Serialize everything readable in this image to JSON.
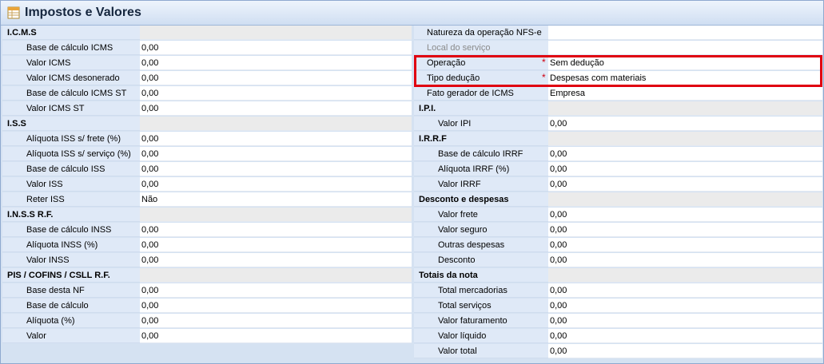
{
  "title": "Impostos e Valores",
  "left": [
    {
      "cat": true,
      "label": "I.C.M.S",
      "value": ""
    },
    {
      "label": "Base de cálculo ICMS",
      "value": "0,00"
    },
    {
      "label": "Valor ICMS",
      "value": "0,00"
    },
    {
      "label": "Valor ICMS desonerado",
      "value": "0,00"
    },
    {
      "label": "Base de cálculo ICMS ST",
      "value": "0,00"
    },
    {
      "label": "Valor ICMS ST",
      "value": "0,00"
    },
    {
      "cat": true,
      "label": "I.S.S",
      "value": ""
    },
    {
      "label": "Alíquota ISS s/ frete (%)",
      "value": "0,00"
    },
    {
      "label": "Alíquota ISS s/ serviço (%)",
      "value": "0,00"
    },
    {
      "label": "Base de cálculo ISS",
      "value": "0,00"
    },
    {
      "label": "Valor ISS",
      "value": "0,00"
    },
    {
      "label": "Reter ISS",
      "value": "Não"
    },
    {
      "cat": true,
      "label": "I.N.S.S R.F.",
      "value": ""
    },
    {
      "label": "Base de cálculo INSS",
      "value": "0,00"
    },
    {
      "label": "Alíquota INSS (%)",
      "value": "0,00"
    },
    {
      "label": "Valor INSS",
      "value": "0,00"
    },
    {
      "cat": true,
      "label": "PIS / COFINS / CSLL R.F.",
      "value": ""
    },
    {
      "label": "Base desta NF",
      "value": "0,00"
    },
    {
      "label": "Base de cálculo",
      "value": "0,00"
    },
    {
      "label": "Alíquota (%)",
      "value": "0,00"
    },
    {
      "label": "Valor",
      "value": "0,00"
    }
  ],
  "right": [
    {
      "top": true,
      "label": "Natureza da operação NFS-e",
      "value": ""
    },
    {
      "top": true,
      "dis": true,
      "label": "Local do serviço",
      "value": ""
    },
    {
      "top": true,
      "req": true,
      "label": "Operação",
      "value": "Sem dedução"
    },
    {
      "top": true,
      "req": true,
      "label": "Tipo dedução",
      "value": "Despesas com materiais"
    },
    {
      "top": true,
      "label": "Fato gerador de ICMS",
      "value": "Empresa"
    },
    {
      "cat": true,
      "label": "I.P.I.",
      "value": ""
    },
    {
      "label": "Valor IPI",
      "value": "0,00"
    },
    {
      "cat": true,
      "label": "I.R.R.F",
      "value": ""
    },
    {
      "label": "Base de cálculo IRRF",
      "value": "0,00"
    },
    {
      "label": "Alíquota IRRF (%)",
      "value": "0,00"
    },
    {
      "label": "Valor IRRF",
      "value": "0,00"
    },
    {
      "cat": true,
      "label": "Desconto e despesas",
      "value": ""
    },
    {
      "label": "Valor frete",
      "value": "0,00"
    },
    {
      "label": "Valor seguro",
      "value": "0,00"
    },
    {
      "label": "Outras despesas",
      "value": "0,00"
    },
    {
      "label": "Desconto",
      "value": "0,00"
    },
    {
      "cat": true,
      "label": "Totais da nota",
      "value": ""
    },
    {
      "label": "Total mercadorias",
      "value": "0,00"
    },
    {
      "label": "Total serviços",
      "value": "0,00"
    },
    {
      "label": "Valor faturamento",
      "value": "0,00"
    },
    {
      "label": "Valor líquido",
      "value": "0,00"
    },
    {
      "label": "Valor total",
      "value": "0,00"
    }
  ],
  "required_mark": "*"
}
